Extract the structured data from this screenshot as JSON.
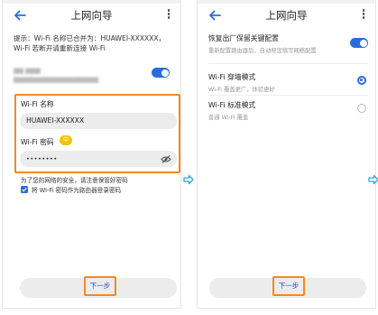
{
  "left_screen": {
    "header": {
      "title": "上网向导"
    },
    "hint": {
      "line1": "提示：Wi-Fi 名称已合并为：HUAWEI-XXXXXX，",
      "line2": "Wi-Fi 若断开请重新连接 Wi-Fi"
    },
    "obscured_setting": {
      "enabled": true
    },
    "wifi_name": {
      "label": "Wi-Fi 名称",
      "value": "HUAWEI-XXXXXX"
    },
    "wifi_password": {
      "label": "Wi-Fi 密码",
      "badge": "中",
      "value": "••••••••"
    },
    "security_note": "为了您的网络的安全，请注意保管好密码",
    "checkbox": {
      "label": "将 Wi-Fi 密码作为路由器登录密码",
      "checked": true
    },
    "next_button": "下一步"
  },
  "right_screen": {
    "header": {
      "title": "上网向导"
    },
    "restore_config": {
      "title": "恢复出厂保留关键配置",
      "subtitle": "重新配置路由器后，自动帮您填写网络配置",
      "enabled": true
    },
    "modes": [
      {
        "title": "Wi-Fi 穿墙模式",
        "subtitle": "Wi-Fi 覆盖更广，体验更好",
        "selected": true
      },
      {
        "title": "Wi-Fi 标准模式",
        "subtitle": "普通 Wi-Fi 覆盖",
        "selected": false
      }
    ],
    "next_button": "下一步"
  },
  "colors": {
    "accent": "#2a6cde",
    "highlight": "#f08a24",
    "button_text": "#1d4fb8",
    "badge": "#f4c300",
    "arrow": "#2aa7d8"
  },
  "icons": {
    "back": "back-arrow-icon",
    "more": "more-vertical-icon",
    "eye": "eye-hidden-icon",
    "next_arrow": "right-arrow-icon"
  }
}
